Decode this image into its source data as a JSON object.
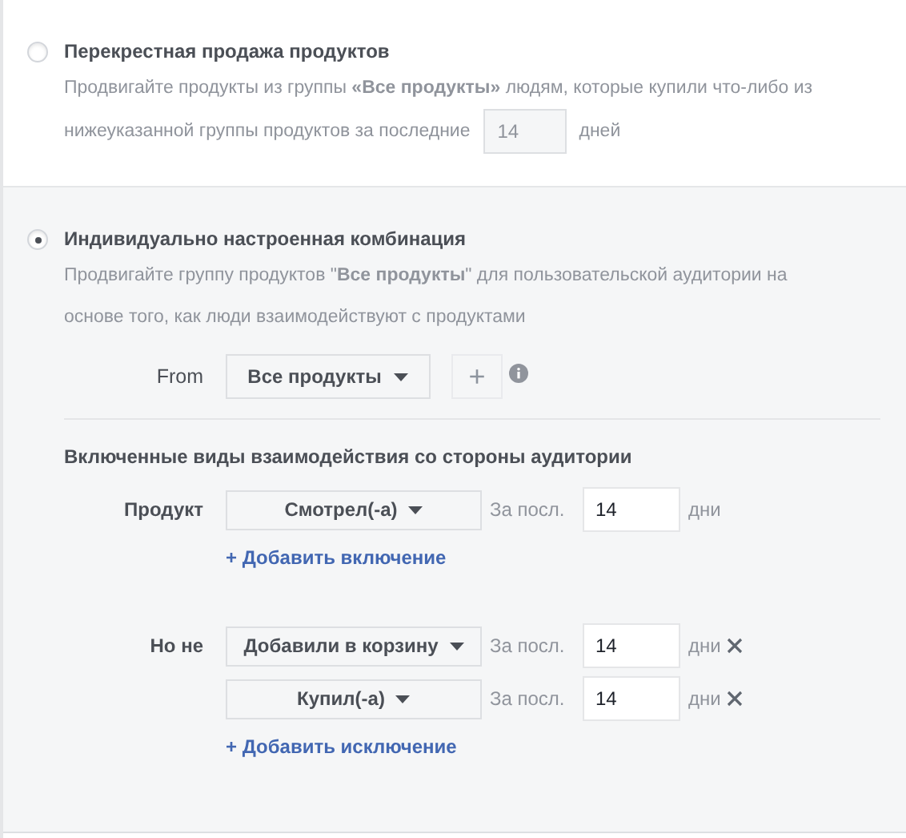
{
  "options": [
    {
      "title": "Перекрестная продажа продуктов",
      "selected": false,
      "description": "Продвигайте продукты из группы **«Все продукты»** людям, которые купили что-либо из",
      "description_continued": "нижеуказанной группы продуктов за последние",
      "days": {
        "value": "14",
        "unit": "дней",
        "disabled": true
      }
    },
    {
      "title": "Индивидуально настроенная комбинация",
      "selected": true,
      "description": "Продвигайте группу продуктов \"**Все продукты**\" для пользовательской аудитории на основе того, как люди взаимодействуют с продуктами"
    }
  ],
  "from": {
    "label": "From",
    "dropdown": "Все продукты",
    "add_button": "+",
    "add_disabled": true
  },
  "interactions": {
    "heading": "Включенные виды взаимодействия со стороны аудитории",
    "groups": [
      {
        "label": "Продукт",
        "link": "+ Добавить включение",
        "rules": [
          {
            "action": "Смотрел(-а)",
            "period": "За посл.",
            "days": "14",
            "unit": "дни",
            "removable": false
          }
        ]
      },
      {
        "label": "Но не",
        "link": "+ Добавить исключение",
        "rules": [
          {
            "action": "Добавили в корзину",
            "period": "За посл.",
            "days": "14",
            "unit": "дни",
            "removable": true
          },
          {
            "action": "Купил(-а)",
            "period": "За посл.",
            "days": "14",
            "unit": "дни",
            "removable": true
          }
        ]
      }
    ]
  }
}
